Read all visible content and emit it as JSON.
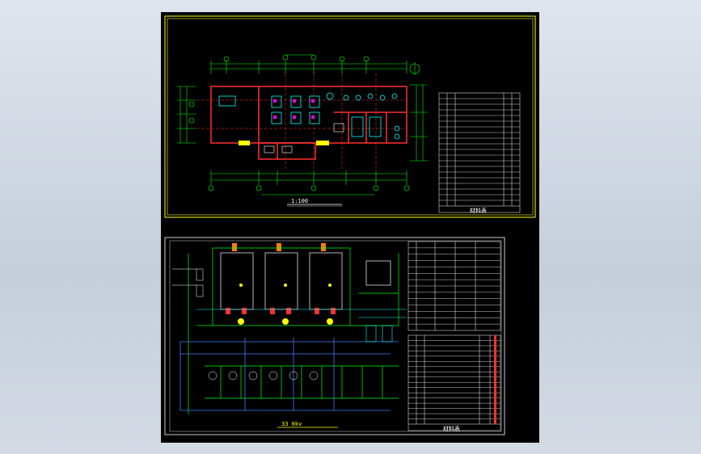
{
  "viewer": {
    "background_color": "#d6dce5",
    "canvas_color": "#000000"
  },
  "sheet1": {
    "title_text": "1:100",
    "frame_color": "#ffff00",
    "table_caption": "材料表",
    "table_rows": 20
  },
  "sheet2": {
    "title_text": "33 0kv",
    "frame_color": "#ffffff",
    "table_caption": "材料表",
    "upper_table_rows": 14,
    "lower_table_rows": 17
  },
  "colors": {
    "wall": "#ff3030",
    "dim": "#00ff00",
    "equip": "#00ffff",
    "yellow": "#ffff00",
    "magenta": "#ff00ff",
    "white": "#ffffff",
    "blue": "#4080ff"
  }
}
